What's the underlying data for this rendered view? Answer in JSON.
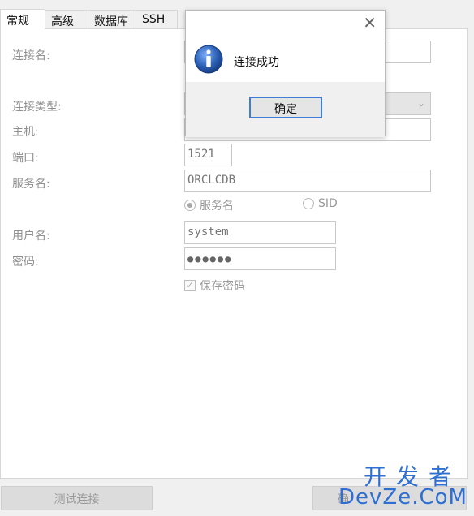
{
  "tabs": [
    {
      "label": "常规",
      "active": true
    },
    {
      "label": "高级",
      "active": false
    },
    {
      "label": "数据库",
      "active": false
    },
    {
      "label": "SSH",
      "active": false
    }
  ],
  "form": {
    "connection_name_label": "连接名:",
    "connection_type_label": "连接类型:",
    "host_label": "主机:",
    "port_label": "端口:",
    "port_value": "1521",
    "service_name_label": "服务名:",
    "service_name_value": "ORCLCDB",
    "radio_service_name": "服务名",
    "radio_sid": "SID",
    "username_label": "用户名:",
    "username_value": "system",
    "password_label": "密码:",
    "password_value": "●●●●●●",
    "save_password_label": "保存密码",
    "save_password_checked": true
  },
  "buttons": {
    "test_connection": "测试连接",
    "confirm_partial": "确"
  },
  "dialog": {
    "message": "连接成功",
    "ok_label": "确定",
    "icon": "info-icon"
  },
  "watermark": {
    "line1": "开发者",
    "line2": "DevZe.CoM"
  },
  "colors": {
    "accent": "#3c7ed6",
    "info_icon": "#2f64b8"
  }
}
